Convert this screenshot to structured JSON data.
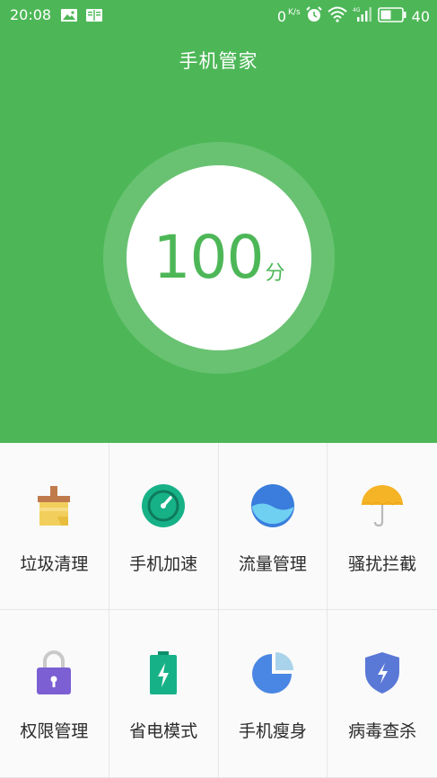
{
  "status_bar": {
    "time": "20:08",
    "data_speed": "0",
    "data_unit": "K/s",
    "battery": "40"
  },
  "header": {
    "title": "手机管家"
  },
  "score": {
    "value": "100",
    "unit": "分"
  },
  "colors": {
    "primary": "#4db757"
  },
  "tools": [
    {
      "label": "垃圾清理",
      "icon": "broom-icon"
    },
    {
      "label": "手机加速",
      "icon": "speedometer-icon"
    },
    {
      "label": "流量管理",
      "icon": "data-wave-icon"
    },
    {
      "label": "骚扰拦截",
      "icon": "umbrella-icon"
    },
    {
      "label": "权限管理",
      "icon": "lock-icon"
    },
    {
      "label": "省电模式",
      "icon": "battery-bolt-icon"
    },
    {
      "label": "手机瘦身",
      "icon": "pie-chart-icon"
    },
    {
      "label": "病毒查杀",
      "icon": "shield-bolt-icon"
    }
  ]
}
